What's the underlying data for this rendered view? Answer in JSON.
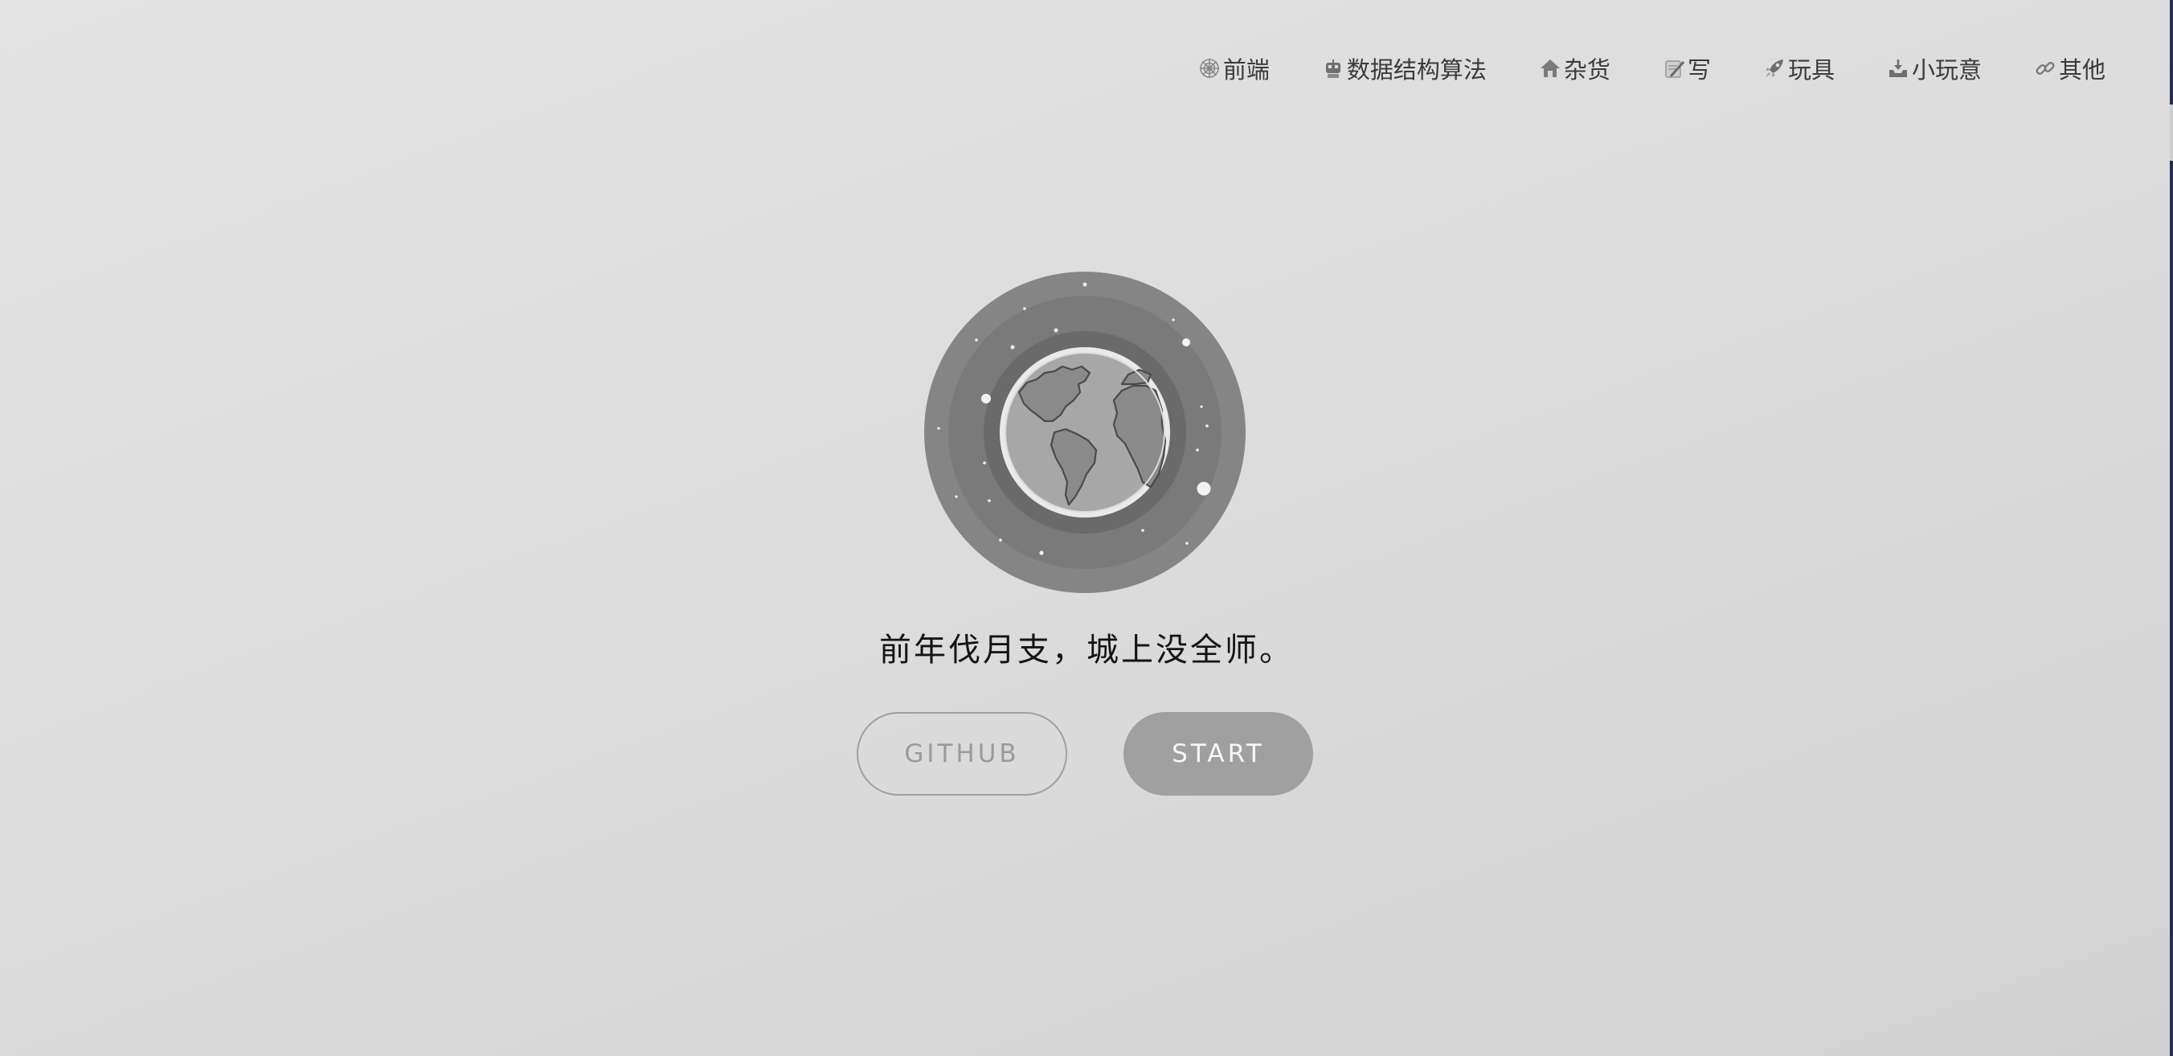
{
  "nav": {
    "items": [
      {
        "label": "前端",
        "icon": "spider-web-icon"
      },
      {
        "label": "数据结构算法",
        "icon": "robot-icon"
      },
      {
        "label": "杂货",
        "icon": "house-icon"
      },
      {
        "label": "写",
        "icon": "memo-icon"
      },
      {
        "label": "玩具",
        "icon": "rocket-icon"
      },
      {
        "label": "小玩意",
        "icon": "inbox-tray-icon"
      },
      {
        "label": "其他",
        "icon": "link-icon"
      }
    ]
  },
  "hero": {
    "image": "earth-globe-in-space-icon",
    "motto": "前年伐月支，城上没全师。",
    "buttons": {
      "github": "GITHUB",
      "start": "START"
    }
  },
  "colors": {
    "background_top": "#e3e3e3",
    "background_bottom": "#d2d2d2",
    "start_button": "#a0a0a0",
    "github_border": "#9e9e9e"
  }
}
